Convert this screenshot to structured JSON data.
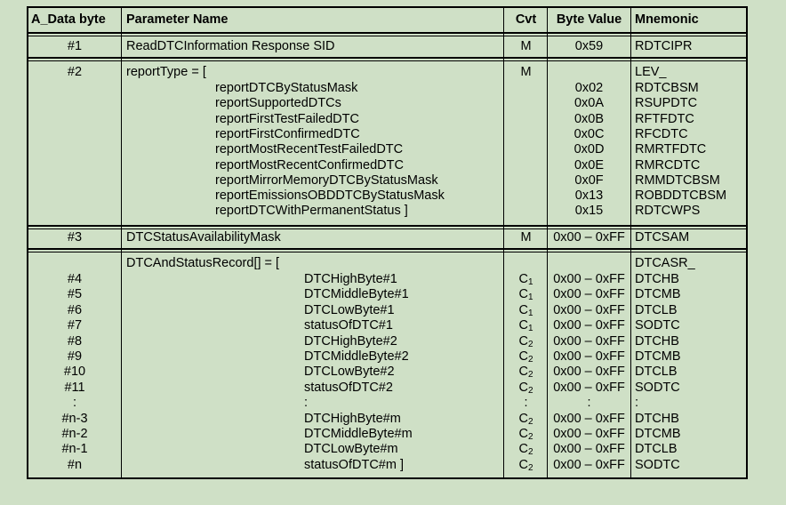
{
  "headers": {
    "a_data_byte": "A_Data byte",
    "param_name": "Parameter Name",
    "cvt": "Cvt",
    "byte_value": "Byte Value",
    "mnemonic": "Mnemonic"
  },
  "row1": {
    "byte": "#1",
    "name": "ReadDTCInformation Response SID",
    "cvt": "M",
    "value": "0x59",
    "mnemonic": "RDTCIPR"
  },
  "row2": {
    "byte": "#2",
    "name": "reportType = [",
    "cvt": "M",
    "mnemonic": "LEV_",
    "items": [
      {
        "name": "reportDTCByStatusMask",
        "value": "0x02",
        "mnemonic": "RDTCBSM"
      },
      {
        "name": "reportSupportedDTCs",
        "value": "0x0A",
        "mnemonic": "RSUPDTC"
      },
      {
        "name": "reportFirstTestFailedDTC",
        "value": "0x0B",
        "mnemonic": "RFTFDTC"
      },
      {
        "name": "reportFirstConfirmedDTC",
        "value": "0x0C",
        "mnemonic": "RFCDTC"
      },
      {
        "name": "reportMostRecentTestFailedDTC",
        "value": "0x0D",
        "mnemonic": "RMRTFDTC"
      },
      {
        "name": "reportMostRecentConfirmedDTC",
        "value": "0x0E",
        "mnemonic": "RMRCDTC"
      },
      {
        "name": "reportMirrorMemoryDTCByStatusMask",
        "value": "0x0F",
        "mnemonic": "RMMDTCBSM"
      },
      {
        "name": "reportEmissionsOBDDTCByStatusMask",
        "value": "0x13",
        "mnemonic": "ROBDDTCBSM"
      },
      {
        "name": "reportDTCWithPermanentStatus ]",
        "value": "0x15",
        "mnemonic": "RDTCWPS"
      }
    ]
  },
  "row3": {
    "byte": "#3",
    "name": "DTCStatusAvailabilityMask",
    "cvt": "M",
    "value": "0x00 – 0xFF",
    "mnemonic": "DTCSAM"
  },
  "row4": {
    "name": "DTCAndStatusRecord[] = [",
    "mnemonic": "DTCASR_",
    "items": [
      {
        "byte": "#4",
        "name": "DTCHighByte#1",
        "cvt": "C",
        "cvt_sub": "1",
        "value": "0x00 – 0xFF",
        "mnemonic": "DTCHB"
      },
      {
        "byte": "#5",
        "name": "DTCMiddleByte#1",
        "cvt": "C",
        "cvt_sub": "1",
        "value": "0x00 – 0xFF",
        "mnemonic": "DTCMB"
      },
      {
        "byte": "#6",
        "name": "DTCLowByte#1",
        "cvt": "C",
        "cvt_sub": "1",
        "value": "0x00 – 0xFF",
        "mnemonic": "DTCLB"
      },
      {
        "byte": "#7",
        "name": "statusOfDTC#1",
        "cvt": "C",
        "cvt_sub": "1",
        "value": "0x00 – 0xFF",
        "mnemonic": "SODTC"
      },
      {
        "byte": "#8",
        "name": "DTCHighByte#2",
        "cvt": "C",
        "cvt_sub": "2",
        "value": "0x00 – 0xFF",
        "mnemonic": "DTCHB"
      },
      {
        "byte": "#9",
        "name": "DTCMiddleByte#2",
        "cvt": "C",
        "cvt_sub": "2",
        "value": "0x00 – 0xFF",
        "mnemonic": "DTCMB"
      },
      {
        "byte": "#10",
        "name": "DTCLowByte#2",
        "cvt": "C",
        "cvt_sub": "2",
        "value": "0x00 – 0xFF",
        "mnemonic": "DTCLB"
      },
      {
        "byte": "#11",
        "name": "statusOfDTC#2",
        "cvt": "C",
        "cvt_sub": "2",
        "value": "0x00 – 0xFF",
        "mnemonic": "SODTC"
      },
      {
        "byte": ":",
        "name": ":",
        "cvt": ":",
        "cvt_sub": "",
        "value": ":",
        "mnemonic": ":"
      },
      {
        "byte": "#n-3",
        "name": "DTCHighByte#m",
        "cvt": "C",
        "cvt_sub": "2",
        "value": "0x00 – 0xFF",
        "mnemonic": "DTCHB"
      },
      {
        "byte": "#n-2",
        "name": "DTCMiddleByte#m",
        "cvt": "C",
        "cvt_sub": "2",
        "value": "0x00 – 0xFF",
        "mnemonic": "DTCMB"
      },
      {
        "byte": "#n-1",
        "name": "DTCLowByte#m",
        "cvt": "C",
        "cvt_sub": "2",
        "value": "0x00 – 0xFF",
        "mnemonic": "DTCLB"
      },
      {
        "byte": "#n",
        "name": "statusOfDTC#m ]",
        "cvt": "C",
        "cvt_sub": "2",
        "value": "0x00 – 0xFF",
        "mnemonic": "SODTC"
      }
    ]
  }
}
